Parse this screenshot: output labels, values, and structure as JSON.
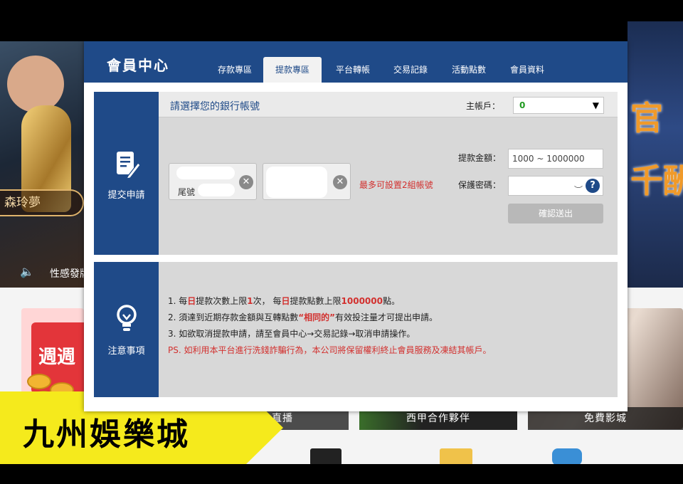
{
  "background": {
    "left_name": "森玲夢",
    "left_caption": "性感發牌",
    "right_text_1": "官",
    "right_text_2": "千酬",
    "promo_left_text": "週週",
    "captions": [
      "直播",
      "西甲合作夥伴",
      "免費影城"
    ]
  },
  "banner": {
    "title": "九州娛樂城",
    "color": "#f5ea1c"
  },
  "modal": {
    "title": "會員中心",
    "tabs": [
      {
        "label": "存款專區"
      },
      {
        "label": "提款專區"
      },
      {
        "label": "平台轉帳"
      },
      {
        "label": "交易記錄"
      },
      {
        "label": "活動點數"
      },
      {
        "label": "會員資料"
      }
    ],
    "active_tab": "提款專區",
    "submit_section": {
      "side_label": "提交申請",
      "bank_header": "請選擇您的銀行帳號",
      "main_account_label": "主帳戶：",
      "main_account_value": "0",
      "card_tail_label": "尾號",
      "max_note": "最多可設置2組帳號",
      "amount_label": "提款金額：",
      "amount_placeholder": "1000 ~ 1000000",
      "password_label": "保護密碼：",
      "submit_label": "確認送出"
    },
    "notes_section": {
      "side_label": "注意事項",
      "line1": {
        "a": "1. 每",
        "b": "日",
        "c": "提款次數上限",
        "d": "1",
        "e": "次， 每",
        "f": "日",
        "g": "提款點數上限",
        "h": "1000000",
        "i": "點。"
      },
      "line2": {
        "a": "2. 須達到近期存款金額與互轉點數",
        "b": "“相同的”",
        "c": "有效投注量才可提出申請。"
      },
      "line3": "3. 如欲取消提款申請，請至會員中心→交易記錄→取消申請操作。",
      "ps": "PS. 如利用本平台進行洗錢詐騙行為，本公司將保留權利終止會員服務及凍結其帳戶。"
    }
  },
  "colors": {
    "header_blue": "#1f4a88",
    "accent_red": "#d2302e",
    "account_green": "#1f9a1f"
  }
}
